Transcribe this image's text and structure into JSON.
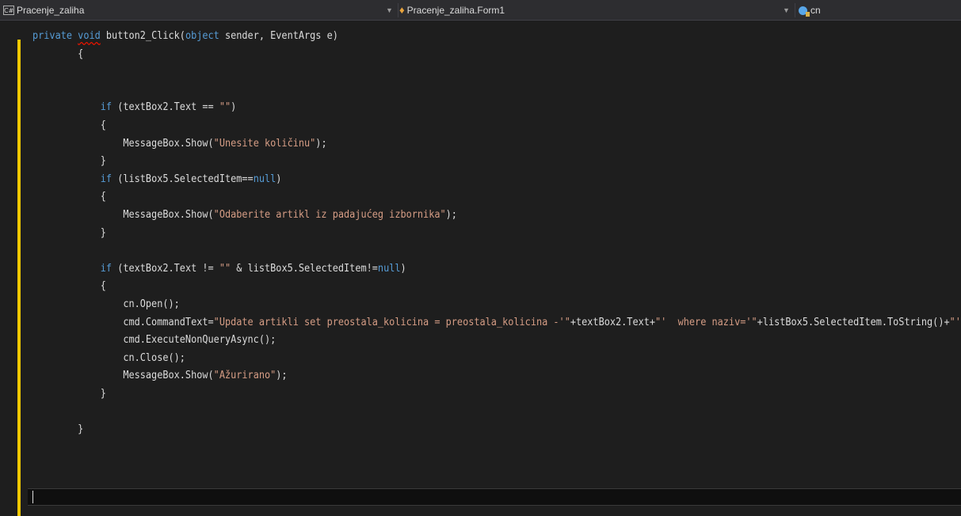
{
  "navbar": {
    "project": "Pracenje_zaliha",
    "class": "Pracenje_zaliha.Form1",
    "member": "cn"
  },
  "code_lines": [
    [
      {
        "t": "private",
        "c": "kw"
      },
      {
        "t": " "
      },
      {
        "t": "void",
        "c": "kw squig"
      },
      {
        "t": " button2_Click("
      },
      {
        "t": "object",
        "c": "kw"
      },
      {
        "t": " sender, EventArgs e)"
      }
    ],
    [
      {
        "t": "        {"
      }
    ],
    [
      {
        "t": ""
      }
    ],
    [
      {
        "t": ""
      }
    ],
    [
      {
        "t": "            "
      },
      {
        "t": "if",
        "c": "kw"
      },
      {
        "t": " (textBox2.Text == "
      },
      {
        "t": "\"\"",
        "c": "str"
      },
      {
        "t": ")"
      }
    ],
    [
      {
        "t": "            {"
      }
    ],
    [
      {
        "t": "                MessageBox.Show("
      },
      {
        "t": "\"Unesite količinu\"",
        "c": "str"
      },
      {
        "t": ");"
      }
    ],
    [
      {
        "t": "            }"
      }
    ],
    [
      {
        "t": "            "
      },
      {
        "t": "if",
        "c": "kw"
      },
      {
        "t": " (listBox5.SelectedItem=="
      },
      {
        "t": "null",
        "c": "kw"
      },
      {
        "t": ")"
      }
    ],
    [
      {
        "t": "            {"
      }
    ],
    [
      {
        "t": "                MessageBox.Show("
      },
      {
        "t": "\"Odaberite artikl iz padajućeg izbornika\"",
        "c": "str"
      },
      {
        "t": ");"
      }
    ],
    [
      {
        "t": "            }"
      }
    ],
    [
      {
        "t": ""
      }
    ],
    [
      {
        "t": "            "
      },
      {
        "t": "if",
        "c": "kw"
      },
      {
        "t": " (textBox2.Text != "
      },
      {
        "t": "\"\"",
        "c": "str"
      },
      {
        "t": " & listBox5.SelectedItem!="
      },
      {
        "t": "null",
        "c": "kw"
      },
      {
        "t": ")"
      }
    ],
    [
      {
        "t": "            {"
      }
    ],
    [
      {
        "t": "                cn.Open();"
      }
    ],
    [
      {
        "t": "                cmd.CommandText="
      },
      {
        "t": "\"Update artikli set preostala_kolicina = preostala_kolicina -'\"",
        "c": "str"
      },
      {
        "t": "+textBox2.Text+"
      },
      {
        "t": "\"'  where naziv='\"",
        "c": "str"
      },
      {
        "t": "+listBox5.SelectedItem.ToString()+"
      },
      {
        "t": "\"'\"",
        "c": "str"
      },
      {
        "t": ";"
      }
    ],
    [
      {
        "t": "                cmd.ExecuteNonQueryAsync();"
      }
    ],
    [
      {
        "t": "                cn.Close();"
      }
    ],
    [
      {
        "t": "                MessageBox.Show("
      },
      {
        "t": "\"Ažurirano\"",
        "c": "str"
      },
      {
        "t": ");"
      }
    ],
    [
      {
        "t": "            }"
      }
    ],
    [
      {
        "t": ""
      }
    ],
    [
      {
        "t": "        }"
      }
    ]
  ],
  "colors": {
    "background": "#1e1e1e",
    "keyword": "#569cd6",
    "string": "#d69d85",
    "text": "#dcdcdc",
    "change_indicator": "#efc800"
  }
}
